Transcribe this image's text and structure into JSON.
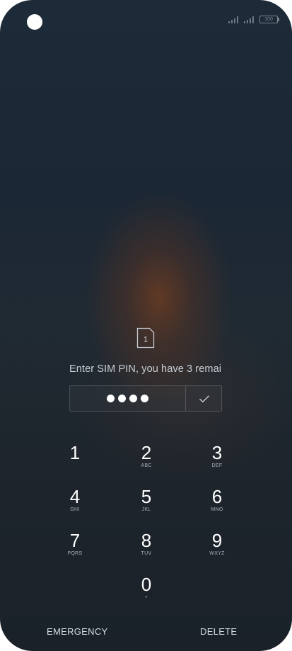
{
  "status_bar": {
    "battery": "100"
  },
  "sim_icon_label": "1",
  "prompt": "Enter SIM PIN, you have 3 remai",
  "pin_entry": {
    "digits_entered": 4
  },
  "keypad": [
    {
      "digit": "1",
      "letters": ""
    },
    {
      "digit": "2",
      "letters": "ABC"
    },
    {
      "digit": "3",
      "letters": "DEF"
    },
    {
      "digit": "4",
      "letters": "GHI"
    },
    {
      "digit": "5",
      "letters": "JKL"
    },
    {
      "digit": "6",
      "letters": "MNO"
    },
    {
      "digit": "7",
      "letters": "PQRS"
    },
    {
      "digit": "8",
      "letters": "TUV"
    },
    {
      "digit": "9",
      "letters": "WXYZ"
    },
    {
      "digit": "0",
      "letters": "+"
    }
  ],
  "buttons": {
    "emergency": "EMERGENCY",
    "delete": "DELETE"
  }
}
